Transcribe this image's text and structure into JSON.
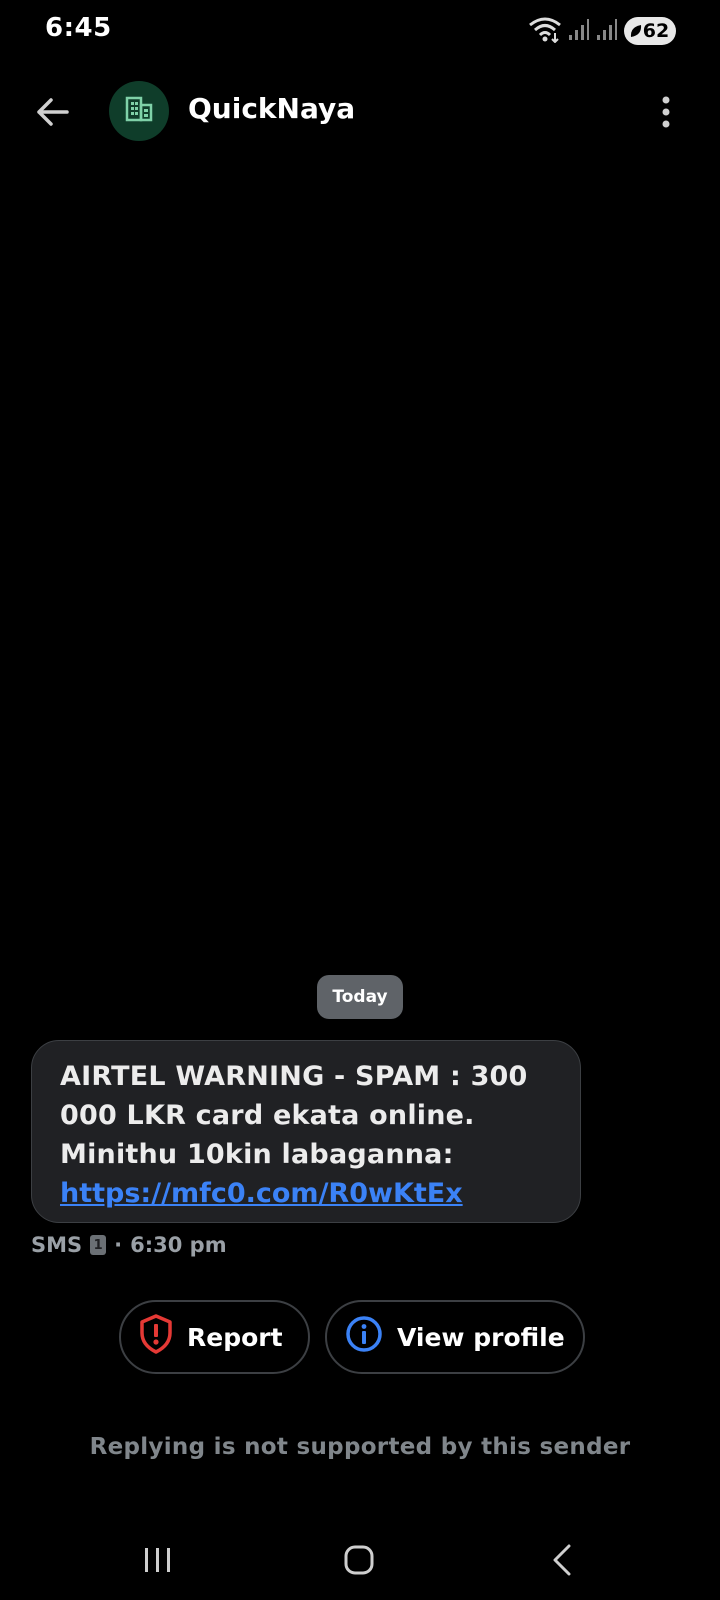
{
  "status_bar": {
    "time": "6:45",
    "battery": "62",
    "icons": [
      "wifi-icon",
      "signal-icon",
      "signal-icon",
      "battery-icon"
    ]
  },
  "header": {
    "title": "QuickNaya",
    "avatar_icon": "business-icon",
    "back_icon": "back-arrow-icon",
    "more_icon": "more-vert-icon"
  },
  "conversation": {
    "date_chip": "Today",
    "message": {
      "text": "AIRTEL WARNING - SPAM : 300 000 LKR card ekata online. Minithu 10kin labaganna:",
      "link": "https://mfc0.com/R0wKtEx",
      "channel": "SMS",
      "sim": "1",
      "separator": "·",
      "time": "6:30 pm"
    }
  },
  "actions": {
    "report_label": "Report",
    "view_profile_label": "View profile"
  },
  "footer": {
    "reply_note": "Replying is not supported by this sender"
  },
  "colors": {
    "background": "#000000",
    "bubble": "#202124",
    "link": "#3b82f6",
    "report_icon": "#e53935",
    "info_icon": "#3b82f6",
    "avatar_bg": "#0f3d2a"
  }
}
